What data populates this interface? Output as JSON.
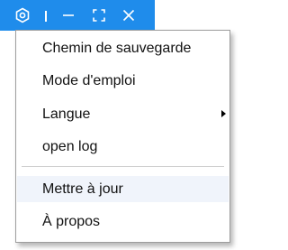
{
  "titlebar": {
    "accent_color": "#1f8ceb",
    "icons": [
      "settings-icon",
      "separator",
      "minimize-icon",
      "maximize-icon",
      "close-icon"
    ]
  },
  "menu": {
    "items": [
      {
        "label": "Chemin de sauvegarde"
      },
      {
        "label": "Mode d'emploi"
      },
      {
        "label": "Langue",
        "submenu": true
      },
      {
        "label": "open log"
      },
      {
        "label": "Mettre à jour",
        "highlighted": true
      },
      {
        "label": "À propos"
      }
    ]
  }
}
